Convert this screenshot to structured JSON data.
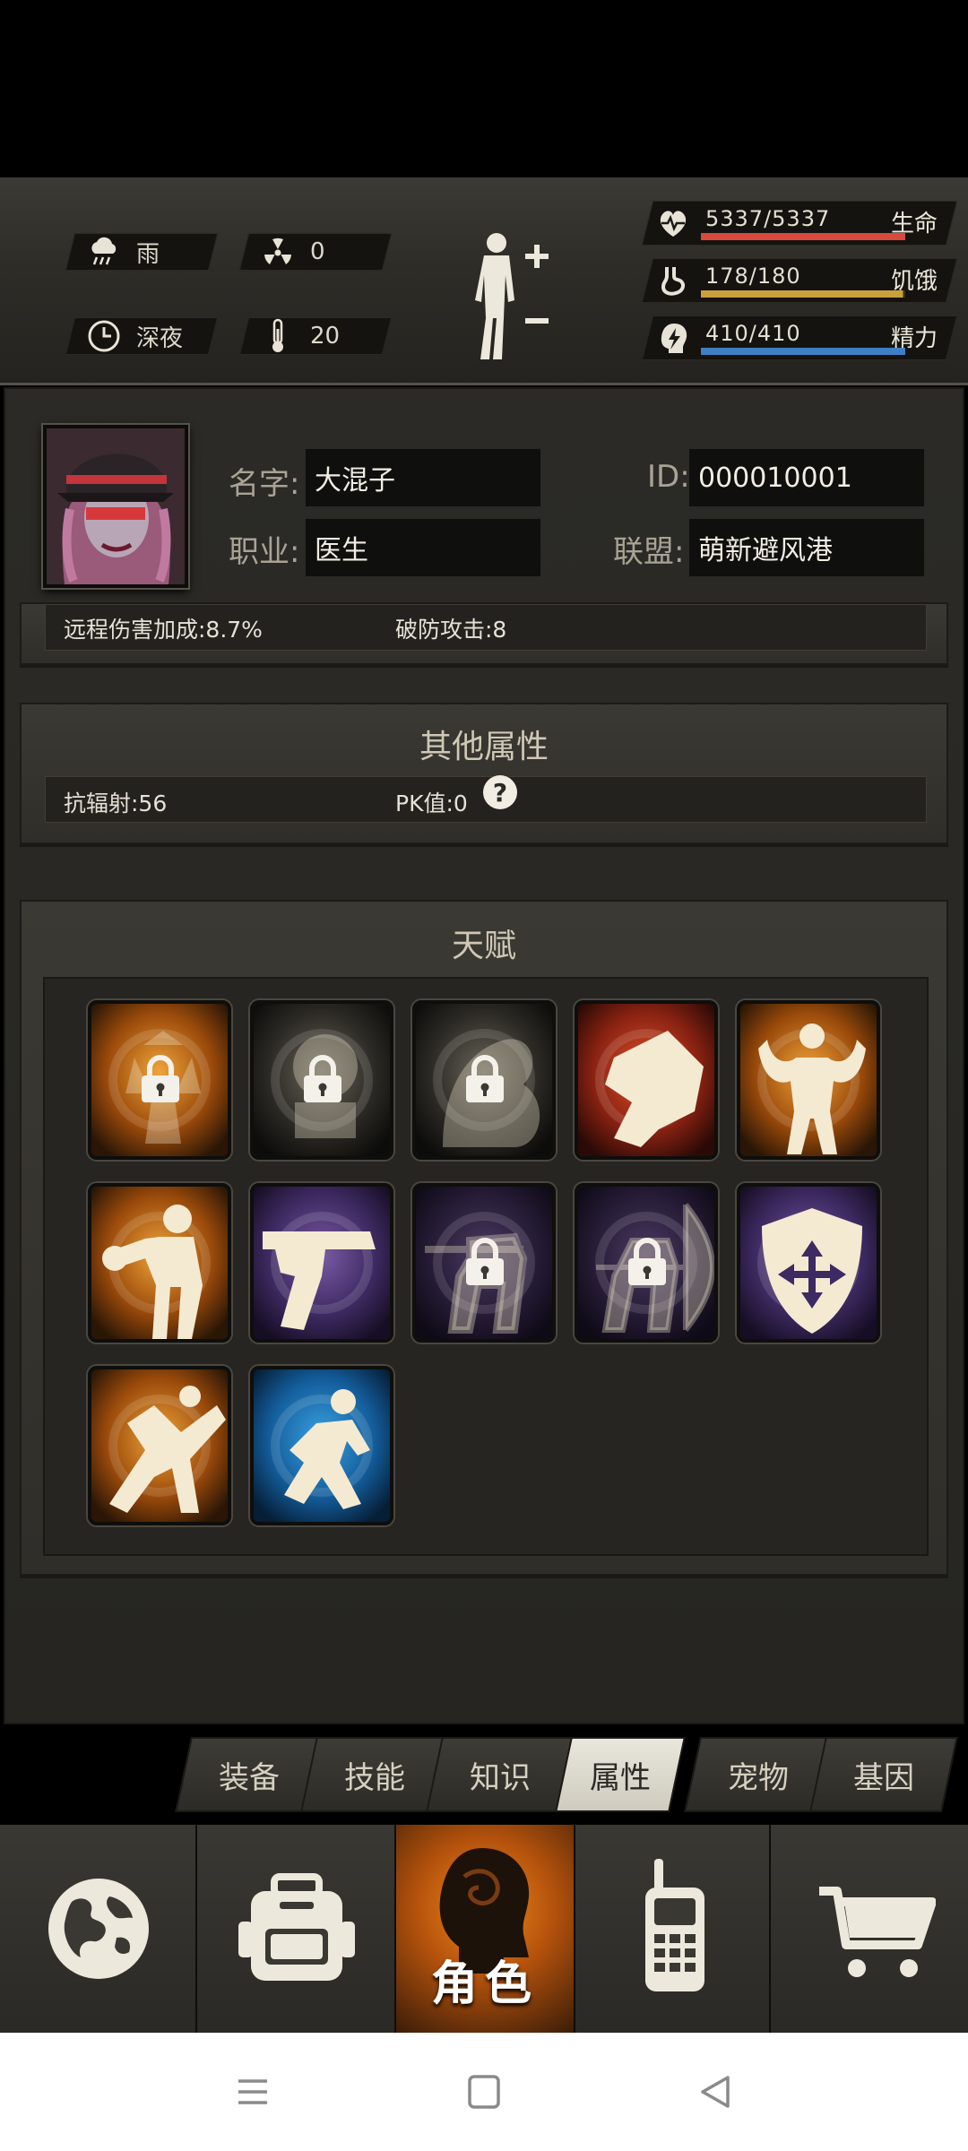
{
  "hud": {
    "weather": "雨",
    "radiation": "0",
    "time_of_day": "深夜",
    "temperature": "20",
    "stats": [
      {
        "value": "5337/5337",
        "label": "生命",
        "color": "#d9493c",
        "fill": 1.0
      },
      {
        "value": "178/180",
        "label": "饥饿",
        "color": "#c9a13c",
        "fill": 0.989
      },
      {
        "value": "410/410",
        "label": "精力",
        "color": "#3f7fc4",
        "fill": 1.0
      }
    ]
  },
  "profile": {
    "name_label": "名字:",
    "name_value": "大混子",
    "id_label": "ID:",
    "id_value": "000010001",
    "job_label": "职业:",
    "job_value": "医生",
    "alliance_label": "联盟:",
    "alliance_value": "萌新避风港"
  },
  "combat_attrs": {
    "ranged_bonus": "远程伤害加成:8.7%",
    "armor_pierce": "破防攻击:8"
  },
  "other_attrs": {
    "title": "其他属性",
    "radiation_resist": "抗辐射:56",
    "pk_value": "PK值:0",
    "help": "?"
  },
  "talents": {
    "title": "天赋",
    "items": [
      {
        "name": "carrier",
        "locked": true,
        "theme": "orange"
      },
      {
        "name": "scholar",
        "locked": true,
        "theme": "dark"
      },
      {
        "name": "shadow",
        "locked": true,
        "theme": "dark"
      },
      {
        "name": "fist",
        "locked": false,
        "theme": "red"
      },
      {
        "name": "strongman",
        "locked": false,
        "theme": "orange"
      },
      {
        "name": "boxer",
        "locked": false,
        "theme": "orange"
      },
      {
        "name": "pistol",
        "locked": false,
        "theme": "purple"
      },
      {
        "name": "rifleman",
        "locked": true,
        "theme": "purple-dark"
      },
      {
        "name": "archer",
        "locked": true,
        "theme": "purple-dark"
      },
      {
        "name": "shield",
        "locked": false,
        "theme": "purple"
      },
      {
        "name": "dodge",
        "locked": false,
        "theme": "orange"
      },
      {
        "name": "crouch",
        "locked": false,
        "theme": "blue"
      }
    ]
  },
  "tabs": [
    "装备",
    "技能",
    "知识",
    "属性",
    "宠物",
    "基因"
  ],
  "active_tab": "属性",
  "bottom_nav": {
    "items": [
      "map-globe",
      "backpack",
      "character",
      "radio",
      "shop-cart"
    ],
    "active_label": "角色"
  }
}
